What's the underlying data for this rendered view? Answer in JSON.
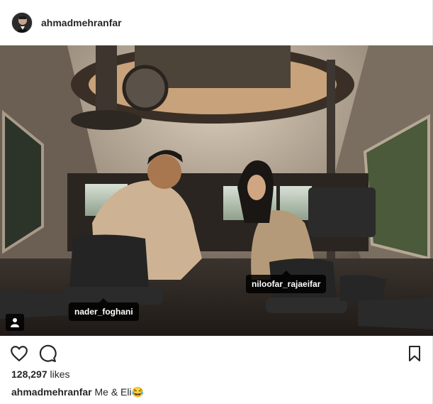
{
  "post": {
    "username": "ahmadmehranfar",
    "likes_count": "128,297",
    "likes_suffix": "likes",
    "caption_user": "ahmadmehranfar",
    "caption_text": "Me & Eli😂"
  },
  "photo": {
    "tags": [
      {
        "label": "nader_foghani"
      },
      {
        "label": "niloofar_rajaeifar"
      }
    ]
  },
  "icons": {
    "like": "heart-icon",
    "comment": "comment-icon",
    "save": "bookmark-icon",
    "tagged": "person-icon"
  }
}
